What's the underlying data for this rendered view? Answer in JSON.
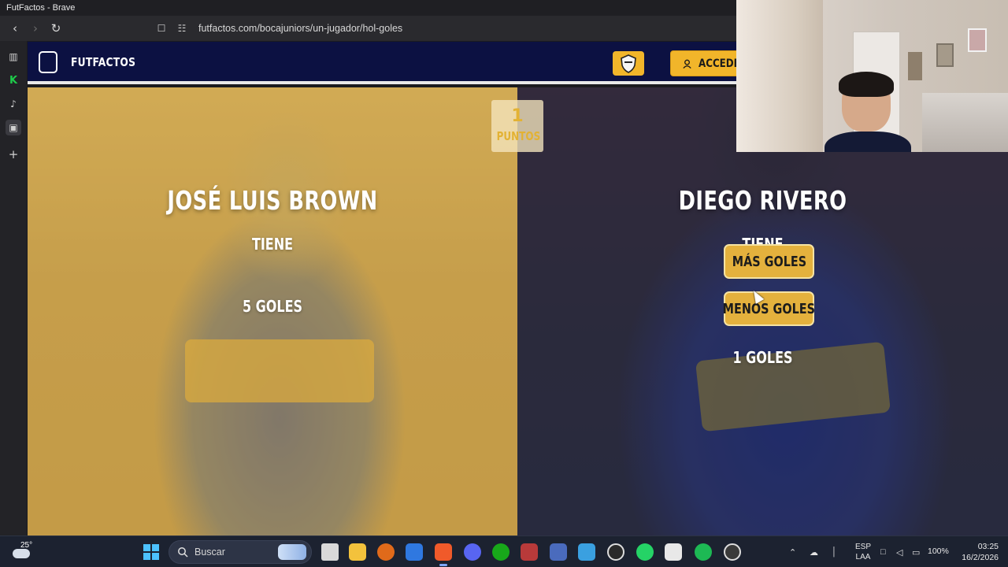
{
  "window": {
    "title": "FutFactos - Brave"
  },
  "browser": {
    "url": "futfactos.com/bocajuniors/un-jugador/hol-goles"
  },
  "site": {
    "brand": "FUTFACTOS",
    "logo_text": "FUT FACTOS",
    "login_label": "ACCEDER"
  },
  "game": {
    "score_value": "1",
    "score_label": "PUNTOS",
    "left_player": {
      "name": "JOSÉ LUIS BROWN",
      "has_label": "TIENE",
      "stat": "5 GOLES"
    },
    "right_player": {
      "name": "DIEGO RIVERO",
      "has_label": "TIENE",
      "stat": "1 GOLES"
    },
    "more_button": "MÁS GOLES",
    "less_button": "MENOS GOLES"
  },
  "taskbar": {
    "weather_temp": "25°",
    "search_label": "Buscar",
    "lang_top": "ESP",
    "lang_bottom": "LAA",
    "battery": "100%",
    "time": "03:25",
    "date": "16/2/2026"
  },
  "colors": {
    "site_header": "#0c1142",
    "accent": "#f1b52a",
    "choice_button": "#e4b13d",
    "taskbar": "#1c2230"
  }
}
